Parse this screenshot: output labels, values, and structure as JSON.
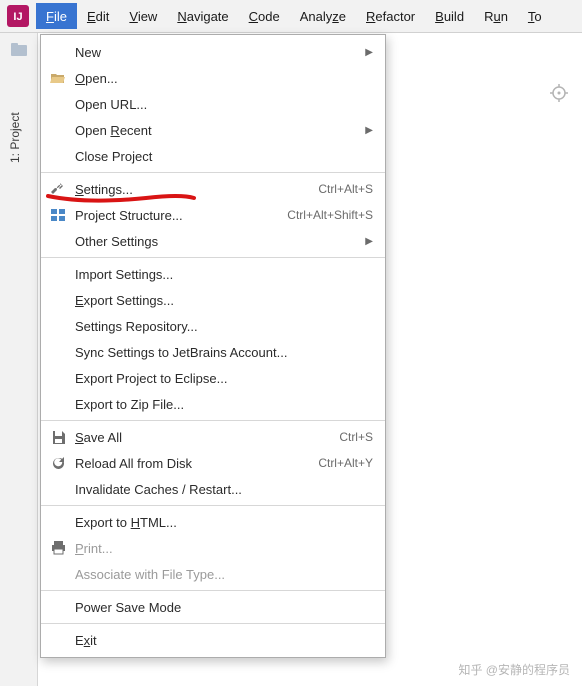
{
  "menubar": {
    "items": [
      {
        "label": "File",
        "mnemonic": "F",
        "active": true
      },
      {
        "label": "Edit",
        "mnemonic": "E"
      },
      {
        "label": "View",
        "mnemonic": "V"
      },
      {
        "label": "Navigate",
        "mnemonic": "N"
      },
      {
        "label": "Code",
        "mnemonic": "C"
      },
      {
        "label": "Analyze",
        "mnemonic": "z",
        "before": "Analy",
        "after": "e"
      },
      {
        "label": "Refactor",
        "mnemonic": "R"
      },
      {
        "label": "Build",
        "mnemonic": "B"
      },
      {
        "label": "Run",
        "mnemonic": "u",
        "before": "R",
        "after": "n"
      },
      {
        "label": "To",
        "mnemonic": "T",
        "after": "o"
      }
    ]
  },
  "sidebar": {
    "project_tab": "1: Project"
  },
  "dropdown": {
    "groups": [
      [
        {
          "icon": "",
          "label": "New",
          "submenu": true
        },
        {
          "icon": "folder-open",
          "label_pre": "",
          "mn": "O",
          "label_post": "pen..."
        },
        {
          "icon": "",
          "label": "Open URL..."
        },
        {
          "icon": "",
          "label_pre": "Open ",
          "mn": "R",
          "label_post": "ecent",
          "submenu": true
        },
        {
          "icon": "",
          "label": "Close Project"
        }
      ],
      [
        {
          "icon": "wrench",
          "label_pre": "",
          "mn": "S",
          "label_post": "ettings...",
          "shortcut": "Ctrl+Alt+S"
        },
        {
          "icon": "structure",
          "label": "Project Structure...",
          "shortcut": "Ctrl+Alt+Shift+S"
        },
        {
          "icon": "",
          "label": "Other Settings",
          "submenu": true
        }
      ],
      [
        {
          "icon": "",
          "label": "Import Settings..."
        },
        {
          "icon": "",
          "label_pre": "",
          "mn": "E",
          "label_post": "xport Settings..."
        },
        {
          "icon": "",
          "label": "Settings Repository..."
        },
        {
          "icon": "",
          "label": "Sync Settings to JetBrains Account..."
        },
        {
          "icon": "",
          "label": "Export Project to Eclipse..."
        },
        {
          "icon": "",
          "label": "Export to Zip File..."
        }
      ],
      [
        {
          "icon": "save",
          "label_pre": "",
          "mn": "S",
          "label_post": "ave All",
          "shortcut": "Ctrl+S"
        },
        {
          "icon": "reload",
          "label": "Reload All from Disk",
          "shortcut": "Ctrl+Alt+Y"
        },
        {
          "icon": "",
          "label": "Invalidate Caches / Restart..."
        }
      ],
      [
        {
          "icon": "",
          "label_pre": "Export to ",
          "mn": "H",
          "label_post": "TML..."
        },
        {
          "icon": "print",
          "label_pre": "",
          "mn": "P",
          "label_post": "rint...",
          "disabled": true
        },
        {
          "icon": "",
          "label": "Associate with File Type...",
          "disabled": true
        }
      ],
      [
        {
          "icon": "",
          "label": "Power Save Mode"
        }
      ],
      [
        {
          "icon": "",
          "label_pre": "E",
          "mn": "x",
          "label_post": "it"
        }
      ]
    ]
  },
  "watermark": "知乎 @安静的程序员"
}
